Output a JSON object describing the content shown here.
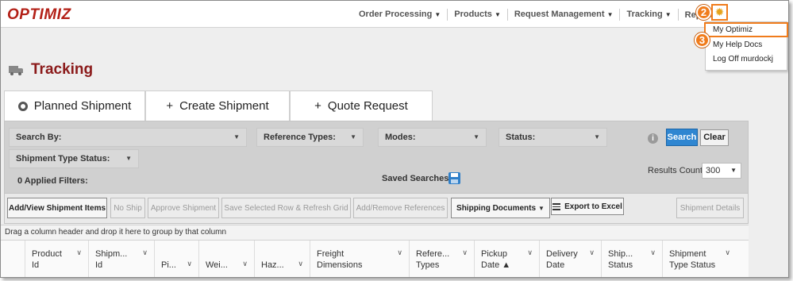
{
  "app": {
    "logo": "OPTIMIZ"
  },
  "nav": {
    "items": [
      {
        "label": "Order Processing",
        "caret": "▼"
      },
      {
        "label": "Products",
        "caret": "▼"
      },
      {
        "label": "Request Management",
        "caret": "▼"
      },
      {
        "label": "Tracking",
        "caret": "▼"
      },
      {
        "label": "Reports",
        "caret": ""
      }
    ]
  },
  "callouts": {
    "step2": "2",
    "step3": "3"
  },
  "icons": {
    "gear": "gear-icon",
    "truck": "truck-icon",
    "info": "info-icon",
    "save": "floppy-disk-icon",
    "export": "export-icon"
  },
  "user_menu": {
    "items": [
      "My Optimiz",
      "My Help Docs",
      "Log Off murdockj"
    ]
  },
  "page": {
    "title": "Tracking"
  },
  "tabs": [
    {
      "label": "Planned Shipment",
      "icon": "radio-icon"
    },
    {
      "label": "Create Shipment",
      "icon": "+"
    },
    {
      "label": "Quote Request",
      "icon": "+"
    }
  ],
  "filters": {
    "search_by": "Search By:",
    "reference_types": "Reference Types:",
    "modes": "Modes:",
    "status": "Status:",
    "shipment_type_status": "Shipment Type Status:",
    "applied_filters": "0 Applied Filters:",
    "saved_searches": "Saved Searches:",
    "search_button": "Search",
    "clear_button": "Clear",
    "results_count_label": "Results Count:",
    "results_count_value": "300"
  },
  "actions": {
    "add_view": "Add/View Shipment Items",
    "no_ship": "No Ship",
    "approve": "Approve Shipment",
    "save_refresh": "Save Selected Row & Refresh Grid",
    "add_remove_refs": "Add/Remove References",
    "shipping_docs": "Shipping Documents",
    "export_excel": "Export to Excel",
    "shipment_details": "Shipment Details"
  },
  "grid": {
    "drag_hint": "Drag a column header and drop it here to group by that column",
    "columns": [
      {
        "l1": "Product",
        "l2": "Id"
      },
      {
        "l1": "Shipm...",
        "l2": "Id"
      },
      {
        "l1": "",
        "l2": "Pi..."
      },
      {
        "l1": "",
        "l2": "Wei..."
      },
      {
        "l1": "",
        "l2": "Haz..."
      },
      {
        "l1": "Freight",
        "l2": "Dimensions"
      },
      {
        "l1": "Refere...",
        "l2": "Types"
      },
      {
        "l1": "Pickup",
        "l2": "Date ▲"
      },
      {
        "l1": "Delivery",
        "l2": "Date"
      },
      {
        "l1": "Ship...",
        "l2": "Status"
      },
      {
        "l1": "Shipment",
        "l2": "Type Status"
      }
    ]
  },
  "colors": {
    "brand": "#b32017",
    "title": "#8b1a1a",
    "callout": "#f07c1c",
    "search_button": "#2f86d1"
  }
}
